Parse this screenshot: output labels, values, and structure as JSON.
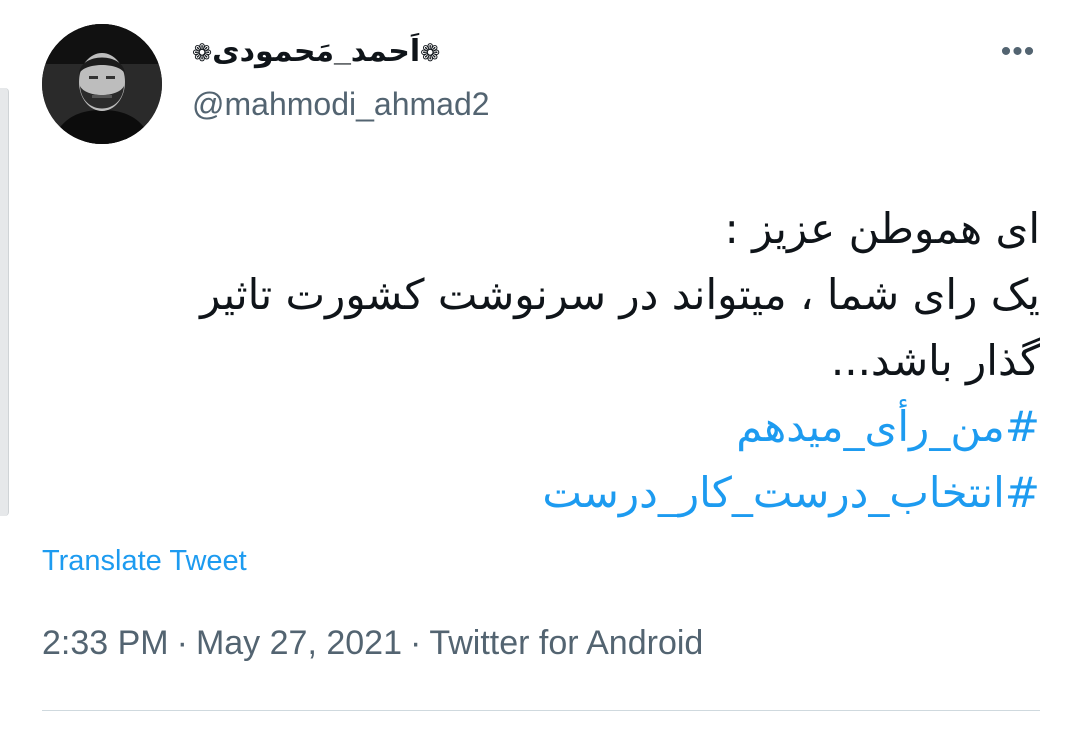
{
  "author": {
    "display_name": "اَحمد_مَحمودی",
    "flower_left": "❁",
    "flower_right": "❁",
    "handle": "@mahmodi_ahmad2",
    "avatar_icon": "profile-photo"
  },
  "header": {
    "more_icon": "more-options-icon",
    "more_glyph": "•••"
  },
  "tweet": {
    "lines": [
      "ای هموطن عزیز :",
      "یک رای شما ، میتواند در سرنوشت کشورت تاثیر",
      "گذار باشد..."
    ],
    "hashtags": [
      "#من_رأی_میدهم",
      "#انتخاب_درست_کار_درست"
    ]
  },
  "translate_label": "Translate Tweet",
  "meta": {
    "time": "2:33 PM",
    "separator": "·",
    "date": "May 27, 2021",
    "source": "Twitter for Android"
  },
  "colors": {
    "link": "#1d9bf0",
    "secondary_text": "#536471",
    "primary_text": "#0f1419"
  }
}
